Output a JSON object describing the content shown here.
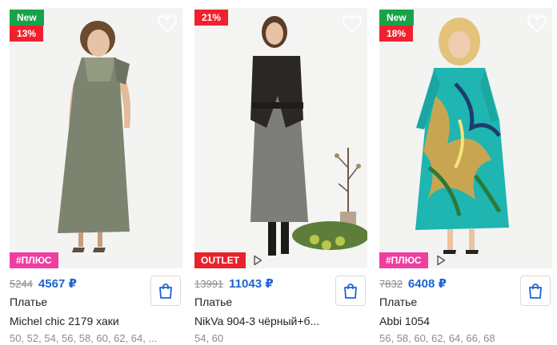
{
  "products": [
    {
      "badges": {
        "new": "New",
        "discount": "13%"
      },
      "tag": "#ПЛЮС",
      "old_price": "5244",
      "price": "4567 ₽",
      "type": "Платье",
      "title": "Michel chic 2179 хаки",
      "sizes": "50, 52, 54, 56, 58, 60, 62, 64, ...",
      "colors": {
        "dress": "#7c8470"
      }
    },
    {
      "badges": {
        "discount": "21%"
      },
      "tag": "OUTLET",
      "old_price": "13991",
      "price": "11043 ₽",
      "type": "Платье",
      "title": "NikVa 904-3 чёрный+б...",
      "sizes": "54, 60",
      "colors": {
        "dress": "#6d6d6a"
      }
    },
    {
      "badges": {
        "new": "New",
        "discount": "18%"
      },
      "tag": "#ПЛЮС",
      "old_price": "7832",
      "price": "6408 ₽",
      "type": "Платье",
      "title": "Abbi 1054",
      "sizes": "56, 58, 60, 62, 64, 66, 68",
      "colors": {
        "dress": "#1fb5b0"
      }
    }
  ],
  "icons": {
    "favorite": "heart-outline-icon",
    "cart": "shopping-bag-icon",
    "video": "play-icon"
  },
  "colors": {
    "new_badge": "#17a34a",
    "discount_badge": "#f0212e",
    "plus_tag": "#ee3fa0",
    "outlet_tag": "#e8232c",
    "price": "#1e63d6"
  }
}
